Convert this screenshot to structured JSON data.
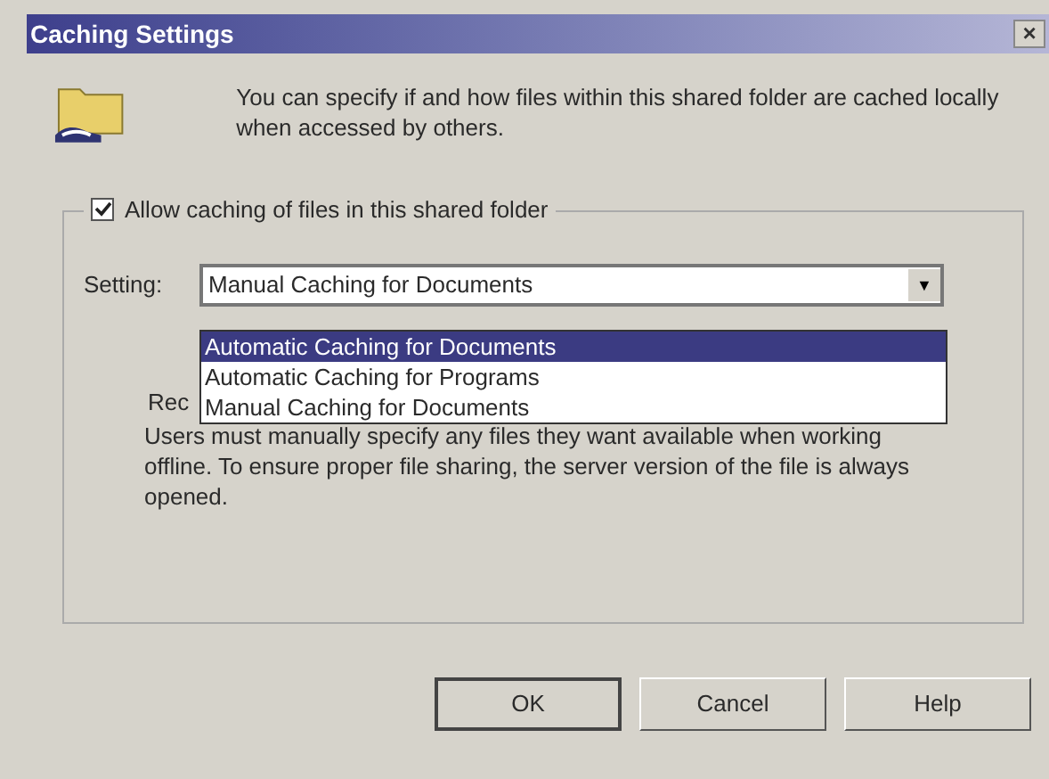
{
  "window": {
    "title": "Caching Settings",
    "close": "×"
  },
  "intro": "You can specify if and how files within this shared folder are cached locally when accessed by others.",
  "allow_caching": {
    "label": "Allow caching of files in this shared folder",
    "checked": true
  },
  "setting": {
    "label": "Setting:",
    "value": "Manual Caching for Documents",
    "arrow": "▼",
    "options": [
      {
        "label": "Automatic Caching for Documents",
        "highlighted": true
      },
      {
        "label": "Automatic Caching for Programs",
        "highlighted": false
      },
      {
        "label": "Manual Caching for Documents",
        "highlighted": false
      }
    ]
  },
  "hidden_label": "Rec",
  "description": "Users must manually specify any files they want available when working offline.  To ensure proper file sharing, the server version of the file is always opened.",
  "buttons": [
    {
      "label": "OK",
      "default": true
    },
    {
      "label": "Cancel",
      "default": false
    },
    {
      "label": "Help",
      "default": false
    }
  ]
}
